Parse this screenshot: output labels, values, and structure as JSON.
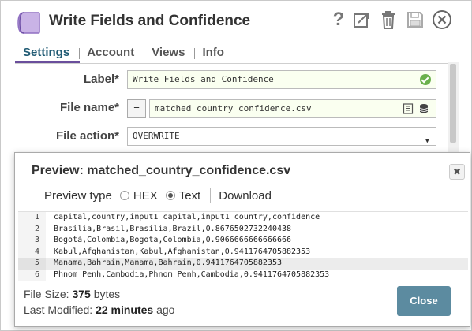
{
  "dialog": {
    "title": "Write Fields and Confidence",
    "icons": [
      "snap-icon",
      "help-icon",
      "export-icon",
      "trash-icon",
      "save-icon",
      "close-icon"
    ],
    "help_glyph": "?"
  },
  "tabs": [
    {
      "label": "Settings",
      "active": true
    },
    {
      "label": "Account",
      "active": false
    },
    {
      "label": "Views",
      "active": false
    },
    {
      "label": "Info",
      "active": false
    }
  ],
  "form": {
    "label_label": "Label*",
    "label_value": "Write Fields and Confidence",
    "filename_label": "File name*",
    "filename_expr": "=",
    "filename_value": "matched_country_confidence.csv",
    "fileaction_label": "File action*",
    "fileaction_value": "OVERWRITE"
  },
  "preview": {
    "title": "Preview: matched_country_confidence.csv",
    "preview_type_label": "Preview type",
    "options": [
      {
        "label": "HEX",
        "selected": false
      },
      {
        "label": "Text",
        "selected": true
      }
    ],
    "download_label": "Download",
    "lines": [
      {
        "n": "1",
        "text": "capital,country,input1_capital,input1_country,confidence",
        "highlight": false
      },
      {
        "n": "2",
        "text": "Brasília,Brasil,Brasilia,Brazil,0.8676502732240438",
        "highlight": false
      },
      {
        "n": "3",
        "text": "Bogotá,Colombia,Bogota,Colombia,0.9066666666666666",
        "highlight": false
      },
      {
        "n": "4",
        "text": "Kabul,Afghanistan,Kabul,Afghanistan,0.9411764705882353",
        "highlight": false
      },
      {
        "n": "5",
        "text": "Manama,Bahrain,Manama,Bahrain,0.9411764705882353",
        "highlight": true
      },
      {
        "n": "6",
        "text": "Phnom Penh,Cambodia,Phnom Penh,Cambodia,0.9411764705882353",
        "highlight": false
      }
    ],
    "file_size_label": "File Size:",
    "file_size_value": "375",
    "file_size_unit": "bytes",
    "last_modified_label": "Last Modified:",
    "last_modified_value": "22 minutes",
    "last_modified_suffix": "ago",
    "close_label": "Close",
    "close_glyph": "✖"
  },
  "colors": {
    "accent": "#6a4e9c",
    "tab_active": "#1f5a73",
    "close_button": "#5c8ba0",
    "valid_check": "#6ab04c"
  }
}
